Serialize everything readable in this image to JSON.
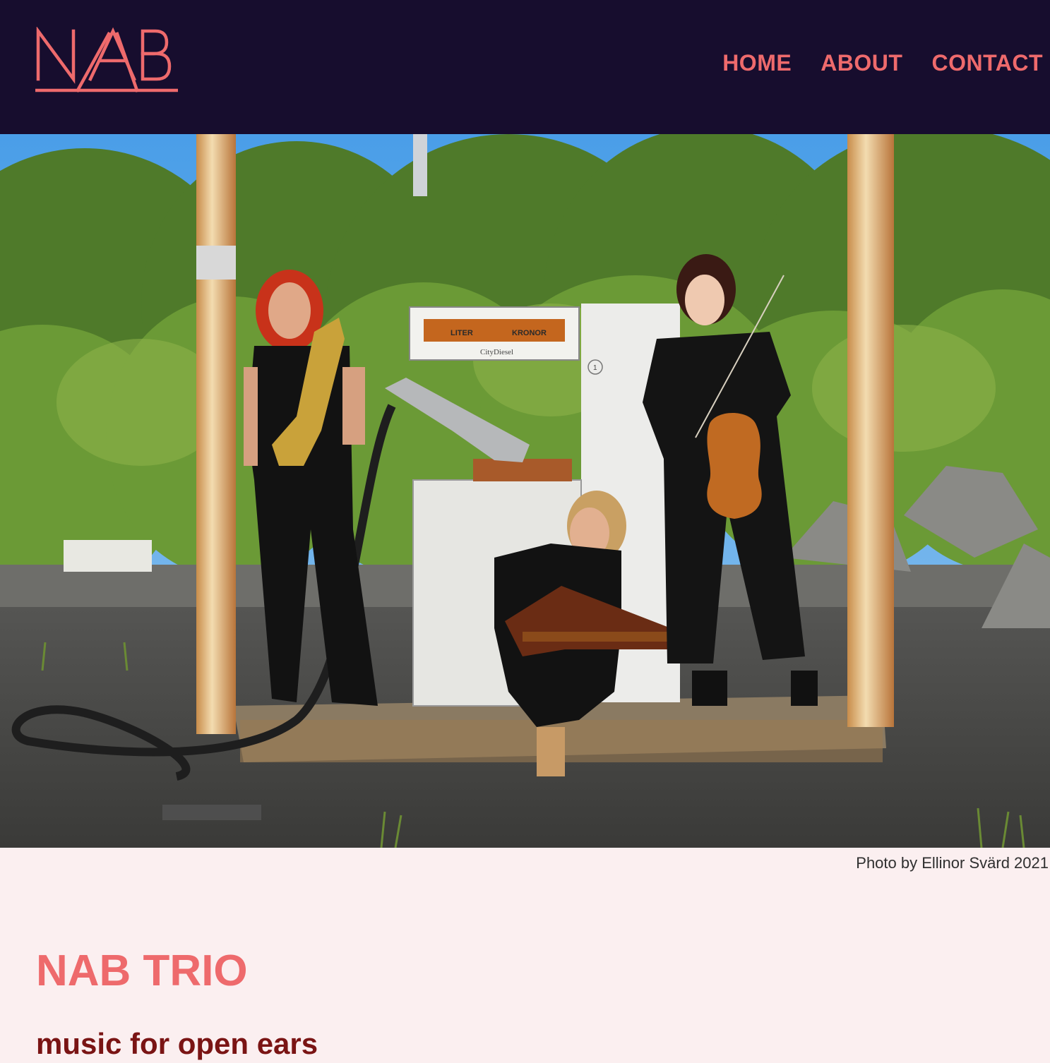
{
  "header": {
    "logo_text": "NAB",
    "nav": {
      "home": "HOME",
      "about": "ABOUT",
      "contact": "CONTACT"
    }
  },
  "hero": {
    "image_label": "band-photo",
    "caption": "Photo by Ellinor Svärd 2021",
    "pump_text": {
      "liter": "LITER",
      "kronor": "KRONOR",
      "brand": "CityDiesel",
      "number": "1"
    }
  },
  "main": {
    "title": "NAB TRIO",
    "subtitle": "music for open ears"
  },
  "colors": {
    "header_bg": "#170d2e",
    "accent": "#ee6a6c",
    "page_bg": "#fbeff0",
    "subtitle": "#7a1414"
  }
}
